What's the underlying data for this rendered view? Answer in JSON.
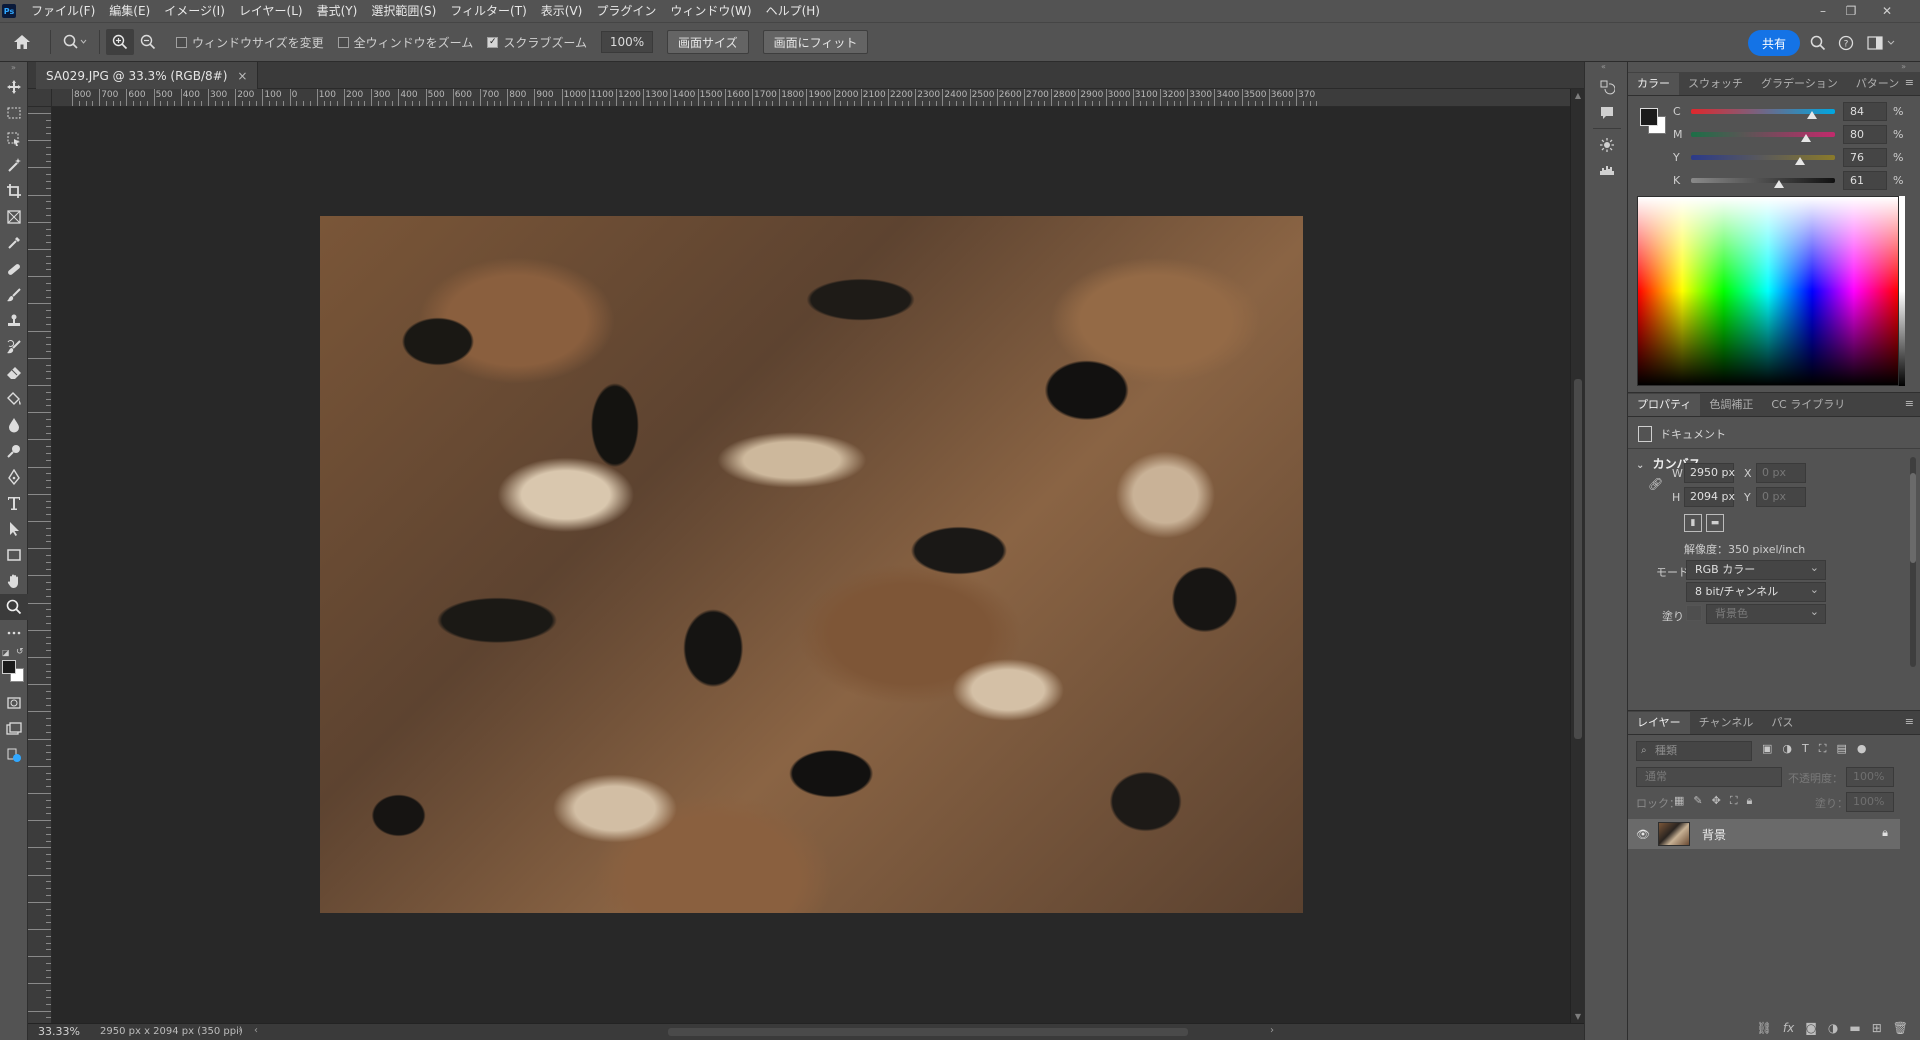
{
  "app": {
    "logo_text": "Ps",
    "menu": [
      "ファイル(F)",
      "編集(E)",
      "イメージ(I)",
      "レイヤー(L)",
      "書式(Y)",
      "選択範囲(S)",
      "フィルター(T)",
      "表示(V)",
      "プラグイン",
      "ウィンドウ(W)",
      "ヘルプ(H)"
    ],
    "window_controls": {
      "minimize": "–",
      "restore": "❐",
      "close": "✕"
    }
  },
  "options_bar": {
    "resize_windows_label": "ウィンドウサイズを変更",
    "resize_windows_checked": false,
    "zoom_all_label": "全ウィンドウをズーム",
    "zoom_all_checked": false,
    "scrubby_zoom_label": "スクラブズーム",
    "scrubby_zoom_checked": true,
    "zoom_value": "100%",
    "screen_size_button": "画面サイズ",
    "fit_screen_button": "画面にフィット",
    "share_button": "共有"
  },
  "document": {
    "tab_title": "SA029.JPG @ 33.3% (RGB/8#)",
    "tab_close": "×"
  },
  "ruler": {
    "labels": [
      "800",
      "700",
      "600",
      "500",
      "400",
      "300",
      "200",
      "100",
      "0",
      "100",
      "200",
      "300",
      "400",
      "500",
      "600",
      "700",
      "800",
      "900",
      "1000",
      "1100",
      "1200",
      "1300",
      "1400",
      "1500",
      "1600",
      "1700",
      "1800",
      "1900",
      "2000",
      "2100",
      "2200",
      "2300",
      "2400",
      "2500",
      "2600",
      "2700",
      "2800",
      "2900",
      "3000",
      "3100",
      "3200",
      "3300",
      "3400",
      "3500",
      "3600",
      "370"
    ]
  },
  "status": {
    "zoom": "33.33%",
    "doc_info": "2950 px x 2094 px (350 ppi)",
    "arrow_right": "›",
    "arrow_left": "‹"
  },
  "color_panel": {
    "tabs": [
      "カラー",
      "スウォッチ",
      "グラデーション",
      "パターン"
    ],
    "active_tab": 0,
    "foreground": "#1b1b1b",
    "background": "#ffffff",
    "channels": [
      {
        "label": "C",
        "value": "84",
        "fraction": 0.84,
        "gradient": "linear-gradient(to right,#e0272c,#00a7e1)"
      },
      {
        "label": "M",
        "value": "80",
        "fraction": 0.8,
        "gradient": "linear-gradient(to right,#1c6f47,#c22a6c)"
      },
      {
        "label": "Y",
        "value": "76",
        "fraction": 0.76,
        "gradient": "linear-gradient(to right,#2b3a8a,#8a7a2a)"
      },
      {
        "label": "K",
        "value": "61",
        "fraction": 0.61,
        "gradient": "linear-gradient(to right,#8a8a8a,#111111)"
      }
    ],
    "percent": "%"
  },
  "properties_panel": {
    "tabs": [
      "プロパティ",
      "色調補正",
      "CC ライブラリ"
    ],
    "active_tab": 0,
    "doc_label": "ドキュメント",
    "section": "カンバス",
    "w_label": "W",
    "w_value": "2950 px",
    "h_label": "H",
    "h_value": "2094 px",
    "x_label": "X",
    "x_value": "0 px",
    "y_label": "Y",
    "y_value": "0 px",
    "resolution": "解像度：350 pixel/inch",
    "mode_label": "モード",
    "mode_value": "RGB カラー",
    "depth_value": "8 bit/チャンネル",
    "fill_label": "塗り",
    "fill_value": "背景色"
  },
  "layers_panel": {
    "tabs": [
      "レイヤー",
      "チャンネル",
      "パス"
    ],
    "active_tab": 0,
    "filter_placeholder": "種類",
    "blend_mode": "通常",
    "opacity_label": "不透明度：",
    "opacity_value": "100%",
    "lock_label": "ロック：",
    "fill_label": "塗り：",
    "fill_value": "100%",
    "layers": [
      {
        "name": "背景",
        "visible": true,
        "locked": true
      }
    ]
  }
}
